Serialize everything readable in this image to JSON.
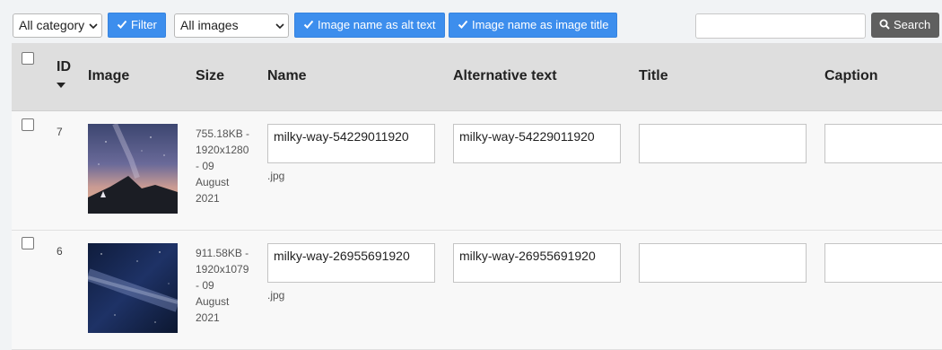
{
  "toolbar": {
    "category_select": "All category",
    "filter_label": "Filter",
    "images_select": "All images",
    "alt_text_btn": "Image name as alt text",
    "title_btn": "Image name as image title",
    "search_placeholder": "",
    "search_label": "Search",
    "accent_color": "#3d8eed"
  },
  "table": {
    "headers": {
      "id": "ID",
      "image": "Image",
      "size": "Size",
      "name": "Name",
      "alt": "Alternative text",
      "title": "Title",
      "caption": "Caption"
    },
    "rows": [
      {
        "id": "7",
        "size_lines": [
          "755.18KB -",
          "1920x1280",
          "- 09",
          "August",
          "2021"
        ],
        "name": "milky-way-54229011920",
        "ext": ".jpg",
        "alt": "milky-way-54229011920",
        "title": "",
        "caption": ""
      },
      {
        "id": "6",
        "size_lines": [
          "911.58KB -",
          "1920x1079",
          "- 09",
          "August",
          "2021"
        ],
        "name": "milky-way-26955691920",
        "ext": ".jpg",
        "alt": "milky-way-26955691920",
        "title": "",
        "caption": ""
      }
    ]
  }
}
